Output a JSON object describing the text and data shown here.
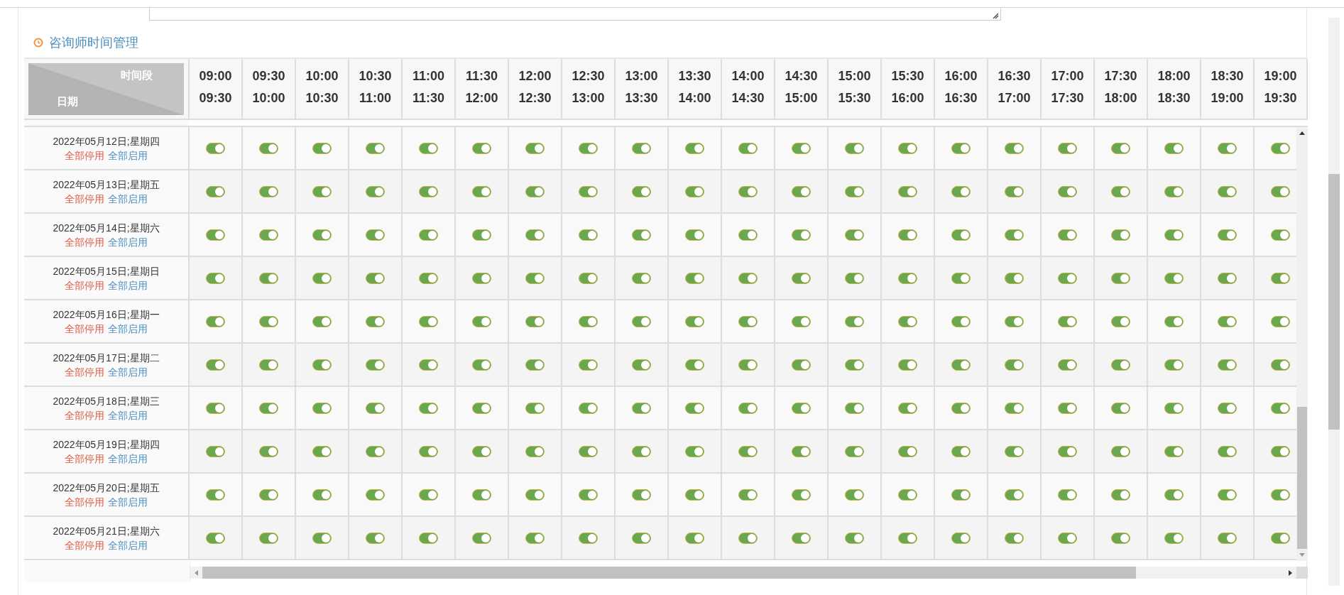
{
  "section": {
    "title": "咨询师时间管理"
  },
  "table": {
    "corner": {
      "top": "时间段",
      "bottom": "日期"
    },
    "columns": [
      {
        "from": "09:00",
        "to": "09:30"
      },
      {
        "from": "09:30",
        "to": "10:00"
      },
      {
        "from": "10:00",
        "to": "10:30"
      },
      {
        "from": "10:30",
        "to": "11:00"
      },
      {
        "from": "11:00",
        "to": "11:30"
      },
      {
        "from": "11:30",
        "to": "12:00"
      },
      {
        "from": "12:00",
        "to": "12:30"
      },
      {
        "from": "12:30",
        "to": "13:00"
      },
      {
        "from": "13:00",
        "to": "13:30"
      },
      {
        "from": "13:30",
        "to": "14:00"
      },
      {
        "from": "14:00",
        "to": "14:30"
      },
      {
        "from": "14:30",
        "to": "15:00"
      },
      {
        "from": "15:00",
        "to": "15:30"
      },
      {
        "from": "15:30",
        "to": "16:00"
      },
      {
        "from": "16:00",
        "to": "16:30"
      },
      {
        "from": "16:30",
        "to": "17:00"
      },
      {
        "from": "17:00",
        "to": "17:30"
      },
      {
        "from": "17:30",
        "to": "18:00"
      },
      {
        "from": "18:00",
        "to": "18:30"
      },
      {
        "from": "18:30",
        "to": "19:00"
      },
      {
        "from": "19:00",
        "to": "19:30"
      }
    ],
    "rows": [
      {
        "date": "2022年05月12日;星期四",
        "disable_all": "全部停用",
        "enable_all": "全部启用",
        "slots": [
          {
            "on": true
          },
          {
            "on": true
          },
          {
            "on": true
          },
          {
            "on": true
          },
          {
            "on": true
          },
          {
            "on": true
          },
          {
            "on": true
          },
          {
            "on": true
          },
          {
            "on": true
          },
          {
            "on": true
          },
          {
            "on": true
          },
          {
            "on": true
          },
          {
            "on": true
          },
          {
            "on": true
          },
          {
            "on": true
          },
          {
            "on": true
          },
          {
            "on": true
          },
          {
            "on": true
          },
          {
            "on": true
          },
          {
            "on": true
          },
          {
            "on": true
          }
        ]
      },
      {
        "date": "2022年05月13日;星期五",
        "disable_all": "全部停用",
        "enable_all": "全部启用",
        "slots": [
          {
            "on": true
          },
          {
            "on": true
          },
          {
            "on": true
          },
          {
            "on": true
          },
          {
            "on": true
          },
          {
            "on": true
          },
          {
            "on": true
          },
          {
            "on": true
          },
          {
            "on": true
          },
          {
            "on": true
          },
          {
            "on": true
          },
          {
            "on": true
          },
          {
            "on": true
          },
          {
            "on": true
          },
          {
            "on": true
          },
          {
            "on": true
          },
          {
            "on": true
          },
          {
            "on": true
          },
          {
            "on": true
          },
          {
            "on": true
          },
          {
            "on": true
          }
        ]
      },
      {
        "date": "2022年05月14日;星期六",
        "disable_all": "全部停用",
        "enable_all": "全部启用",
        "slots": [
          {
            "on": true
          },
          {
            "on": true
          },
          {
            "on": true
          },
          {
            "on": true
          },
          {
            "on": true
          },
          {
            "on": true
          },
          {
            "on": true
          },
          {
            "on": true
          },
          {
            "on": true
          },
          {
            "on": true
          },
          {
            "on": true
          },
          {
            "on": true
          },
          {
            "on": true
          },
          {
            "on": true
          },
          {
            "on": true
          },
          {
            "on": true
          },
          {
            "on": true
          },
          {
            "on": true
          },
          {
            "on": true
          },
          {
            "on": true
          },
          {
            "on": true
          }
        ]
      },
      {
        "date": "2022年05月15日;星期日",
        "disable_all": "全部停用",
        "enable_all": "全部启用",
        "slots": [
          {
            "on": true
          },
          {
            "on": true
          },
          {
            "on": true
          },
          {
            "on": true
          },
          {
            "on": true
          },
          {
            "on": true
          },
          {
            "on": true
          },
          {
            "on": true
          },
          {
            "on": true
          },
          {
            "on": true
          },
          {
            "on": true
          },
          {
            "on": true
          },
          {
            "on": true
          },
          {
            "on": true
          },
          {
            "on": true
          },
          {
            "on": true
          },
          {
            "on": true
          },
          {
            "on": true
          },
          {
            "on": true
          },
          {
            "on": true
          },
          {
            "on": true
          }
        ]
      },
      {
        "date": "2022年05月16日;星期一",
        "disable_all": "全部停用",
        "enable_all": "全部启用",
        "slots": [
          {
            "on": true
          },
          {
            "on": true
          },
          {
            "on": true
          },
          {
            "on": true
          },
          {
            "on": true
          },
          {
            "on": true
          },
          {
            "on": true
          },
          {
            "on": true
          },
          {
            "on": true
          },
          {
            "on": true
          },
          {
            "on": true
          },
          {
            "on": true
          },
          {
            "on": true
          },
          {
            "on": true
          },
          {
            "on": true
          },
          {
            "on": true
          },
          {
            "on": true
          },
          {
            "on": true
          },
          {
            "on": true
          },
          {
            "on": true
          },
          {
            "on": true
          }
        ]
      },
      {
        "date": "2022年05月17日;星期二",
        "disable_all": "全部停用",
        "enable_all": "全部启用",
        "slots": [
          {
            "on": true
          },
          {
            "on": true
          },
          {
            "on": true
          },
          {
            "on": true
          },
          {
            "on": true
          },
          {
            "on": true
          },
          {
            "on": true
          },
          {
            "on": true
          },
          {
            "on": true
          },
          {
            "on": true
          },
          {
            "on": true
          },
          {
            "on": true
          },
          {
            "on": true
          },
          {
            "on": true
          },
          {
            "on": true
          },
          {
            "on": true
          },
          {
            "on": true
          },
          {
            "on": true
          },
          {
            "on": true
          },
          {
            "on": true
          },
          {
            "on": true
          }
        ]
      },
      {
        "date": "2022年05月18日;星期三",
        "disable_all": "全部停用",
        "enable_all": "全部启用",
        "slots": [
          {
            "on": true
          },
          {
            "on": true
          },
          {
            "on": true
          },
          {
            "on": true
          },
          {
            "on": true
          },
          {
            "on": true
          },
          {
            "on": true
          },
          {
            "on": true
          },
          {
            "on": true
          },
          {
            "on": true
          },
          {
            "on": true
          },
          {
            "on": true
          },
          {
            "on": true
          },
          {
            "on": true
          },
          {
            "on": true
          },
          {
            "on": true
          },
          {
            "on": true
          },
          {
            "on": true
          },
          {
            "on": true
          },
          {
            "on": true
          },
          {
            "on": true
          }
        ]
      },
      {
        "date": "2022年05月19日;星期四",
        "disable_all": "全部停用",
        "enable_all": "全部启用",
        "slots": [
          {
            "on": true
          },
          {
            "on": true
          },
          {
            "on": true
          },
          {
            "on": true
          },
          {
            "on": true
          },
          {
            "on": true
          },
          {
            "on": true
          },
          {
            "on": true
          },
          {
            "on": true
          },
          {
            "on": true
          },
          {
            "on": true
          },
          {
            "on": true
          },
          {
            "on": true
          },
          {
            "on": true
          },
          {
            "on": true
          },
          {
            "on": true
          },
          {
            "on": true
          },
          {
            "on": true
          },
          {
            "on": true
          },
          {
            "on": true
          },
          {
            "on": true
          }
        ]
      },
      {
        "date": "2022年05月20日;星期五",
        "disable_all": "全部停用",
        "enable_all": "全部启用",
        "slots": [
          {
            "on": true
          },
          {
            "on": true
          },
          {
            "on": true
          },
          {
            "on": true
          },
          {
            "on": true
          },
          {
            "on": true
          },
          {
            "on": true
          },
          {
            "on": true
          },
          {
            "on": true
          },
          {
            "on": true
          },
          {
            "on": true
          },
          {
            "on": true
          },
          {
            "on": true
          },
          {
            "on": true
          },
          {
            "on": true
          },
          {
            "on": true
          },
          {
            "on": true
          },
          {
            "on": true
          },
          {
            "on": true
          },
          {
            "on": true
          },
          {
            "on": true
          }
        ]
      },
      {
        "date": "2022年05月21日;星期六",
        "disable_all": "全部停用",
        "enable_all": "全部启用",
        "slots": [
          {
            "on": true
          },
          {
            "on": true
          },
          {
            "on": true
          },
          {
            "on": true
          },
          {
            "on": true
          },
          {
            "on": true
          },
          {
            "on": true
          },
          {
            "on": true
          },
          {
            "on": true
          },
          {
            "on": true
          },
          {
            "on": true
          },
          {
            "on": true
          },
          {
            "on": true
          },
          {
            "on": true
          },
          {
            "on": true
          },
          {
            "on": true
          },
          {
            "on": true
          },
          {
            "on": true
          },
          {
            "on": true
          },
          {
            "on": true
          },
          {
            "on": true
          }
        ]
      }
    ]
  }
}
